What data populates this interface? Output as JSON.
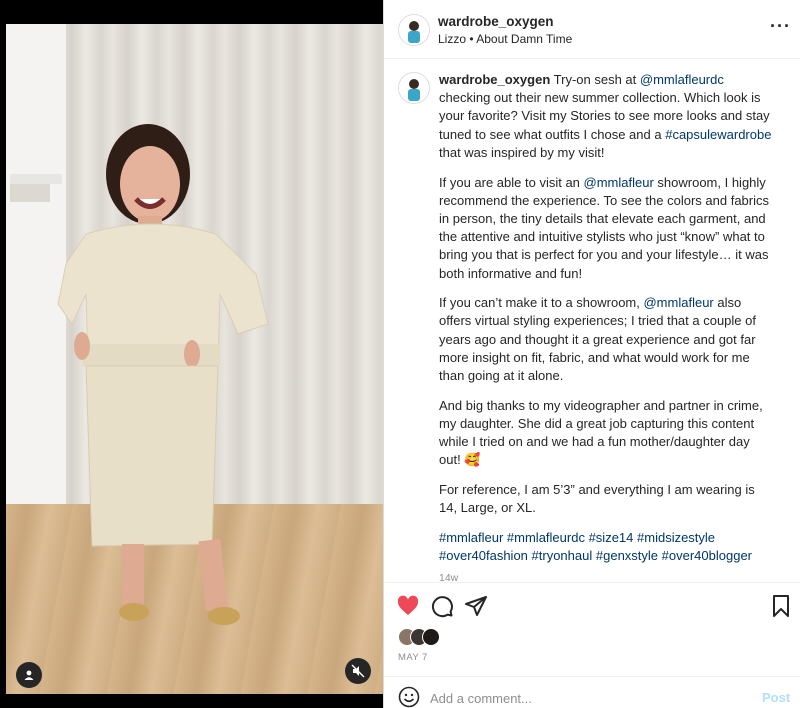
{
  "post": {
    "username": "wardrobe_oxygen",
    "audio": "Lizzo • About Damn Time",
    "more_icon": "more-horizontal-icon",
    "caption": {
      "p1_text_a": "Try-on sesh at ",
      "p1_mention_a": "@mmlafleurdc",
      "p1_text_b": " checking out their new summer collection. Which look is your favorite? Visit my Stories to see more looks and stay tuned to see what outfits I chose and a ",
      "p1_hashtag": "#capsulewardrobe",
      "p1_text_c": " that was inspired by my visit!",
      "p2_text_a": "If you are able to visit an ",
      "p2_mention": "@mmlafleur",
      "p2_text_b": " showroom, I highly recommend the experience. To see the colors and fabrics in person, the tiny details that elevate each garment, and the attentive and intuitive stylists who just “know” what to bring you that is perfect for you and your lifestyle… it was both informative and fun!",
      "p3_text_a": "If you can’t make it to a showroom, ",
      "p3_mention": "@mmlafleur",
      "p3_text_b": " also offers virtual styling experiences; I tried that a couple of years ago and thought it a great experience and got far more insight on fit, fabric, and what would work for me than going at it alone.",
      "p4_text": "And big thanks to my videographer and partner in crime, my daughter. She did a great job capturing this content while I tried on and we had a fun mother/daughter day out! 🥰",
      "p5_text": "For reference, I am 5’3” and everything I am wearing is 14, Large, or XL.",
      "tags": [
        "#mmlafleur",
        "#mmlafleurdc",
        "#size14",
        "#midsizestyle",
        "#over40fashion",
        "#tryonhaul",
        "#genxstyle",
        "#over40blogger"
      ],
      "time": "14w"
    },
    "actions": {
      "like_icon": "heart-filled-icon",
      "comment_icon": "comment-icon",
      "share_icon": "share-icon",
      "save_icon": "bookmark-icon",
      "like_color": "#ed4956"
    },
    "date": "MAY 7",
    "comment": {
      "placeholder": "Add a comment...",
      "post_label": "Post",
      "emoji_icon": "emoji-icon"
    }
  },
  "media": {
    "user_tag_icon": "user-tag-icon",
    "mute_icon": "muted-speaker-icon"
  }
}
